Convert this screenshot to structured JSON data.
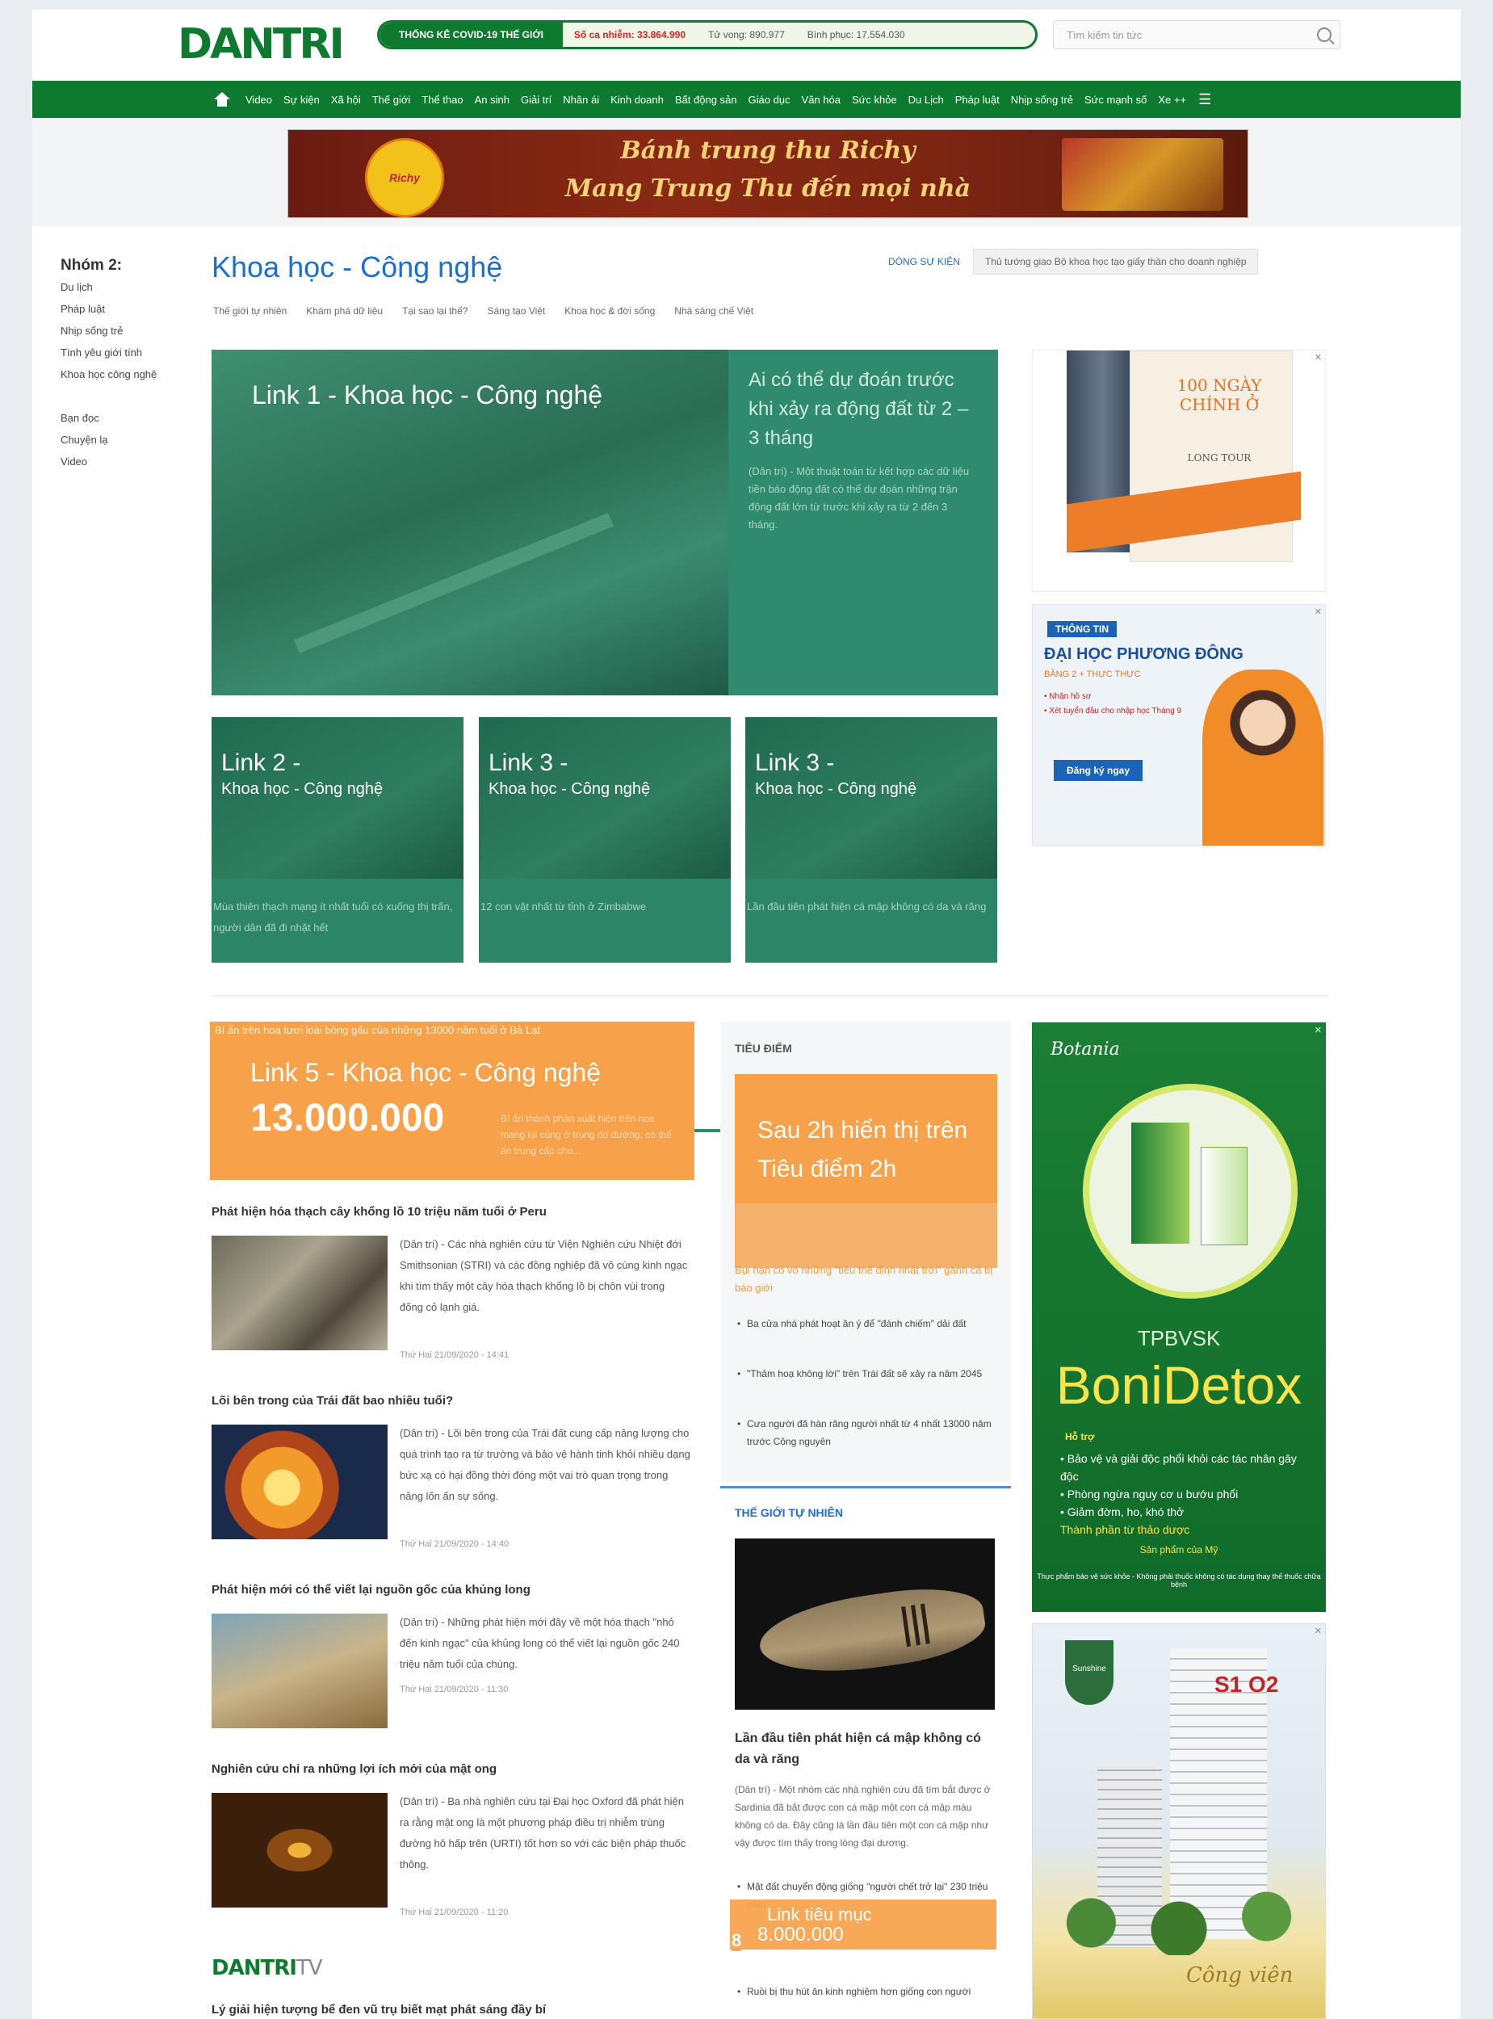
{
  "header": {
    "logo": "DANTRI",
    "stats": {
      "highlight": "THỐNG KÊ COVID-19 THẾ GIỚI",
      "items": [
        "Số ca nhiễm: 33.864.990",
        "Tử vong: 890.977",
        "Bình phục: 17.554.030"
      ]
    },
    "search_placeholder": "Tìm kiếm tin tức"
  },
  "nav": {
    "items": [
      "Video",
      "Sự kiện",
      "Xã hội",
      "Thế giới",
      "Thể thao",
      "An sinh",
      "Giải trí",
      "Nhân ái",
      "Kinh doanh",
      "Bất động sản",
      "Giáo dục",
      "Văn hóa",
      "Sức khỏe",
      "Du Lịch",
      "Pháp luật",
      "Nhịp sống trẻ",
      "Sức mạnh số",
      "Xe ++"
    ],
    "menu_icon": "hamburger-icon"
  },
  "banner": {
    "badge": "Richy",
    "line1": "Bánh trung thu Richy",
    "line2": "Mang Trung Thu đến mọi nhà"
  },
  "left_sidebar": {
    "group_title": "Nhóm 2:",
    "group_items": [
      "Du lịch",
      "Pháp luật",
      "Nhịp sống trẻ",
      "Tình yêu giới tính",
      "Khoa học công nghệ"
    ],
    "other_items": [
      "Bạn đọc",
      "Chuyện lạ",
      "Video"
    ]
  },
  "category": {
    "title": "Khoa học - Công nghệ",
    "subcats": [
      "Thế giới tự nhiên",
      "Khám phá dữ liệu",
      "Tại sao lại thế?",
      "Sáng tạo Việt",
      "Khoa học & đời sống",
      "Nhà sáng chế Việt"
    ],
    "top_link": "DÒNG SỰ KIỆN",
    "top_boxed": "Thủ tướng giao Bộ khoa học tạo giấy thần cho doanh nghiệp"
  },
  "featured": {
    "label": "Link 1 - Khoa học - Công nghệ",
    "title": "Ai có thể dự đoán trước khi xảy ra động đất từ 2 – 3 tháng",
    "desc": "(Dân trí) - Một thuật toán từ kết hợp các dữ liệu tiền báo động đất có thể dự đoán những trận động đất lớn từ trước khi xảy ra từ 2 đến 3 tháng."
  },
  "cards": [
    {
      "label": "Link 2 -",
      "sub": "Khoa học - Công nghệ",
      "desc": "Mùa thiên thạch mạng ít nhất tuổi có xuống thị trấn, người dân đã đi nhặt hết"
    },
    {
      "label": "Link 3 -",
      "sub": "Khoa học - Công nghệ",
      "desc": "12 con vật nhất từ tỉnh ở Zimbabwe"
    },
    {
      "label": "Link 3 -",
      "sub": "Khoa học - Công nghệ",
      "desc": "Lần đầu tiên phát hiện cá mập không có da và răng"
    }
  ],
  "promo": {
    "top": "Bí ẩn trên hoa tươi loài bông gấu của những 13000 năm tuổi ở Bà Lạt",
    "label": "Link 5 - Khoa học - Công nghệ",
    "price": "13.000.000",
    "desc": "Bí ẩn thành phần xuất hiện trên hoa mang lại cùng ở trung đó đường, có thể ẩn trung cấp cho..."
  },
  "articles": [
    {
      "title": "Phát hiện hóa thạch cây khổng lồ 10 triệu năm tuổi ở Peru",
      "desc": "(Dân trí) - Các nhà nghiên cứu từ Viện Nghiên cứu Nhiệt đới Smithsonian (STRI) và các đồng nghiệp đã vô cùng kinh ngạc khi tìm thấy một cây hóa thạch khổng lồ bị chôn vùi trong đống cỏ lạnh giá.",
      "date": "Thứ Hai 21/09/2020 - 14:41"
    },
    {
      "title": "Lõi bên trong của Trái đất bao nhiêu tuổi?",
      "desc": "(Dân trí) - Lõi bên trong của Trái đất cung cấp năng lượng cho quá trình tạo ra từ trường và bảo vệ hành tinh khỏi nhiều dạng bức xạ có hại đồng thời đóng một vai trò quan trọng trong năng lốn ấn sự sống.",
      "date": "Thứ Hai 21/09/2020 - 14:40"
    },
    {
      "title": "Phát hiện mới có thể viết lại nguồn gốc của khủng long",
      "desc": "(Dân trí) - Những phát hiện mới đây về một hóa thạch \"nhỏ đến kinh ngạc\" của khủng long có thể viết lại nguồn gốc 240 triệu năm tuổi của chúng.",
      "date": "Thứ Hai 21/09/2020 - 11:30"
    },
    {
      "title": "Nghiên cứu chỉ ra những lợi ích mới của mật ong",
      "desc": "(Dân trí) - Ba nhà nghiên cứu tại Đại học Oxford đã phát hiện ra rằng mật ong là một phương pháp điều trị nhiễm trùng đường hô hấp trên (URTI) tốt hơn so với các biện pháp thuốc thông.",
      "date": "Thứ Hai 21/09/2020 - 11:20"
    }
  ],
  "tieudiem": {
    "heading": "TIÊU ĐIỂM",
    "image_text": "Sau 2h hiển thị trên Tiêu điểm 2h",
    "sub": "Bụi hạn có vô những \"tiêu thể đỉnh nhất trời\" gánh cả bị báo giới",
    "list": [
      "Ba cửa nhà phát hoạt ăn ý để \"đánh chiếm\" dải đất",
      "\"Thảm hoạ không lời\" trên Trái đất sẽ xảy ra năm 2045",
      "Cưa người đã hàn răng người nhất từ 4 nhất 13000 năm trước Công nguyên"
    ]
  },
  "thegioi": {
    "heading": "THẾ GIỚI TỰ NHIÊN",
    "title": "Lần đầu tiên phát hiện cá mập không có da và răng",
    "desc": "(Dân trí) - Một nhóm các nhà nghiên cứu đã tìm bắt được ở Sardinia đã bắt được con cá mập một con cá mập màu không có da. Đây cũng là lần đầu tiên một con cá mập như vậy được tìm thấy trong lòng đại dương.",
    "link_label": "Link tiêu mục",
    "link_price": "8.000.000",
    "badge": "8",
    "list": [
      "Mặt đất chuyển động giống \"người chết trở lại\" 230 triệu năm",
      "Ruồi bị thu hút ăn kinh nghiệm hơn giống con người"
    ]
  },
  "ads": {
    "ad1_title": "100 NGÀY CHÍNH Ở",
    "ad1_sub": "LONG TOUR",
    "ad2_ribbon": "THÔNG TIN",
    "ad2_title": "ĐẠI HỌC PHƯƠNG ĐÔNG",
    "ad2_sub": "BĂNG 2 + THỰC THỰC",
    "ad2_l1": "• Nhận hồ sơ",
    "ad2_l2": "• Xét tuyển đầu cho nhập học Tháng 9",
    "ad2_btn": "Đăng ký ngay",
    "ad3_brand": "Botania",
    "ad3_tpbvsk": "TPBVSK",
    "ad3_name": "BoniDetox",
    "ad3_support": "Hỗ trợ",
    "ad3_list": [
      "• Bảo vệ và giải độc phổi khỏi các tác nhân gây độc",
      "• Phòng ngừa nguy cơ u bướu phổi",
      "• Giảm đờm, ho, khó thở"
    ],
    "ad3_ingredient": "Thành phần từ thảo dược",
    "ad3_cta": "Sản phẩm của Mỹ",
    "ad3_foot": "Thực phẩm bảo vệ sức khỏe - Không phải thuốc không có tác dụng thay thế thuốc chữa bệnh",
    "ad4_logo": "Sunshine",
    "ad4_num": "S1 O2",
    "ad4_cv": "Công viên"
  },
  "dantri_tv": {
    "logo": "DANTRI",
    "tv": "TV",
    "headline": "Lý giải hiện tượng bể đen vũ trụ biết mạt phát sáng đầy bí"
  }
}
